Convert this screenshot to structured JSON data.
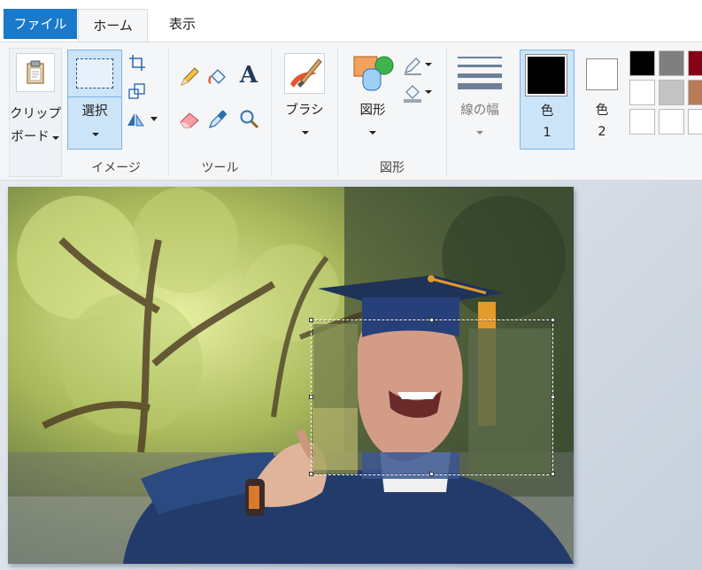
{
  "tabs": {
    "file": "ファイル",
    "home": "ホーム",
    "view": "表示"
  },
  "clipboard": {
    "line1": "クリップ",
    "line2": "ボード"
  },
  "image": {
    "select": "選択",
    "group": "イメージ"
  },
  "tools": {
    "group": "ツール",
    "text_tool": "A"
  },
  "brushes": {
    "label": "ブラシ"
  },
  "shapes": {
    "label": "図形",
    "group": "図形"
  },
  "size": {
    "label": "線の幅"
  },
  "color1": {
    "label": "色",
    "number": "1",
    "value": "#000000"
  },
  "color2": {
    "label": "色",
    "number": "2",
    "value": "#ffffff"
  },
  "palette": [
    "#000000",
    "#7f7f7f",
    "#880015",
    "#ffffff",
    "#c3c3c3",
    "#b97a57",
    "#ffffff",
    "#ffffff",
    "#ffffff"
  ],
  "colors": {
    "accent": "#1979ca",
    "ribbon": "#f5f6f7",
    "gown": "#223b6a",
    "tassel": "#e39a2a"
  }
}
